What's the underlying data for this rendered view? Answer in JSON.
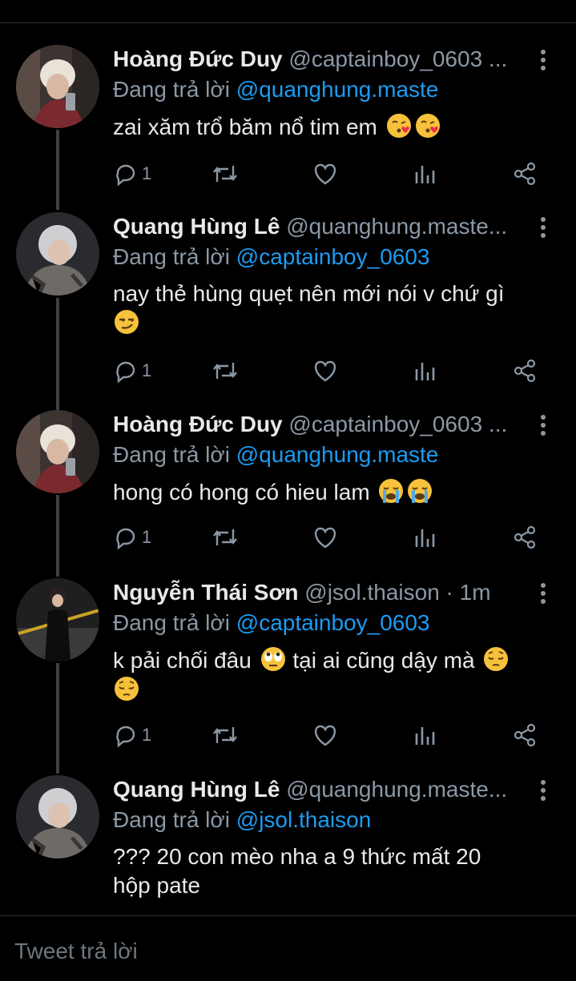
{
  "tweets": [
    {
      "name": "Hoàng Đức Duy",
      "handle": "@captainboy_0603 ...",
      "reply_prefix": "Đang trả lời",
      "reply_to": "@quanghung.maste",
      "text_lines": [
        "zai xăm trổ băm nổ tim em"
      ],
      "emojis": [
        "face-blowing-kiss-emoji",
        "face-blowing-kiss-emoji"
      ],
      "reply_count": "1"
    },
    {
      "name": "Quang Hùng Lê",
      "handle": "@quanghung.maste...",
      "reply_prefix": "Đang trả lời",
      "reply_to": "@captainboy_0603",
      "text_lines": [
        "nay thẻ hùng quẹt nên mới nói v chứ gì"
      ],
      "emojis": [
        "smirking-face-emoji"
      ],
      "reply_count": "1"
    },
    {
      "name": "Hoàng Đức Duy",
      "handle": "@captainboy_0603 ...",
      "reply_prefix": "Đang trả lời",
      "reply_to": "@quanghung.maste",
      "text_lines": [
        "hong có hong có hieu lam"
      ],
      "emojis": [
        "loudly-crying-face-emoji",
        "loudly-crying-face-emoji"
      ],
      "reply_count": "1"
    },
    {
      "name": "Nguyễn Thái Sơn",
      "handle": "@jsol.thaison · 1m",
      "reply_prefix": "Đang trả lời",
      "reply_to": "@captainboy_0603",
      "text_part1": "k pải chối đâu",
      "text_part2": "tại ai cũng dậy mà",
      "emojis": [
        "face-with-rolling-eyes-emoji",
        "pensive-face-emoji",
        "pensive-face-emoji"
      ],
      "reply_count": "1"
    },
    {
      "name": "Quang Hùng Lê",
      "handle": "@quanghung.maste...",
      "reply_prefix": "Đang trả lời",
      "reply_to": "@jsol.thaison",
      "text_lines": [
        "??? 20 con mèo nha a 9 thức mất 20",
        "hộp pate"
      ]
    }
  ],
  "compose": {
    "placeholder": "Tweet trả lời"
  },
  "icons": [
    "reply-icon",
    "retweet-icon",
    "like-icon",
    "analytics-icon",
    "share-icon",
    "more-icon"
  ],
  "colors": {
    "background": "#000000",
    "mention": "#1d9bf0",
    "muted": "#8b98a5",
    "text": "#e7e9ea"
  }
}
